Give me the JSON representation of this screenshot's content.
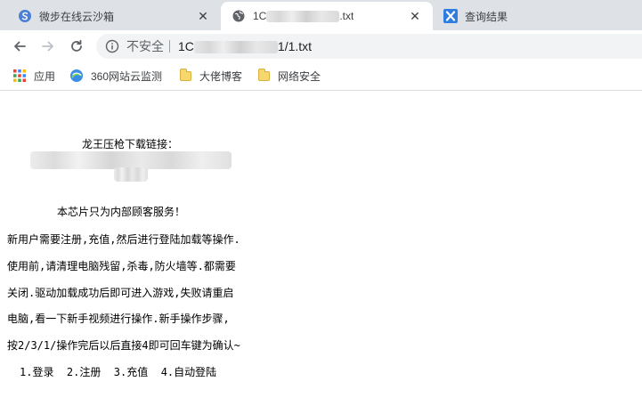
{
  "tabs": [
    {
      "title": "微步在线云沙箱",
      "favicon": "sandbox-icon",
      "close": "✕"
    },
    {
      "title_prefix": "1C",
      "title_suffix": ".txt",
      "favicon": "globe-icon",
      "close": "✕",
      "active": true
    },
    {
      "title": "查询结果",
      "favicon": "x-app-icon",
      "close": "✕"
    }
  ],
  "toolbar": {
    "back_icon": "arrow-left-icon",
    "forward_icon": "arrow-right-icon",
    "reload_icon": "reload-icon",
    "security_label": "不安全",
    "url_prefix": "1C",
    "url_suffix": "1/1.txt"
  },
  "bookmarks": [
    {
      "label": "应用",
      "icon": "apps-grid-icon"
    },
    {
      "label": "360网站云监测",
      "icon": "360-icon"
    },
    {
      "label": "大佬博客",
      "icon": "folder-icon"
    },
    {
      "label": "网络安全",
      "icon": "folder-icon"
    }
  ],
  "content": {
    "lines": [
      "龙王压枪下载链接：",
      "本芯片只为内部顾客服务！",
      "新用户需要注册,充值,然后进行登陆加载等操作.",
      "使用前,请清理电脑残留,杀毒,防火墙等.都需要",
      "关闭.驱动加载成功后即可进入游戏,失败请重启",
      "电脑,看一下新手视频进行操作.新手操作步骤,",
      "按2/3/1/操作完后以后直接4即可回车键为确认~",
      "1.登录  2.注册  3.充值  4.自动登陆"
    ]
  },
  "colors": {
    "tab_strip": "#dee1e6",
    "omnibox": "#f1f3f4",
    "folder": "#f5d76e"
  }
}
